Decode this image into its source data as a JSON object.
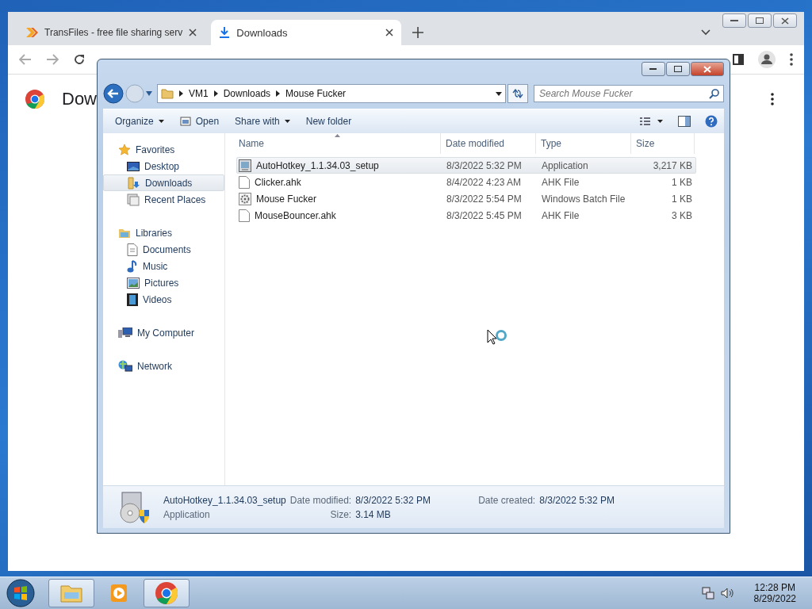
{
  "chrome": {
    "tabs": [
      {
        "label": "TransFiles - free file sharing serv",
        "selected": false,
        "kind": "transfiles"
      },
      {
        "label": "Downloads",
        "selected": true,
        "kind": "download"
      }
    ],
    "page_heading": "Dow"
  },
  "explorer": {
    "breadcrumb": [
      "VM1",
      "Downloads",
      "Mouse Fucker"
    ],
    "search": {
      "placeholder": "Search Mouse Fucker"
    },
    "commands": [
      {
        "label": "Organize",
        "kind": "menu"
      },
      {
        "label": "Open",
        "kind": "icon"
      },
      {
        "label": "Share with",
        "kind": "menu"
      },
      {
        "label": "New folder",
        "kind": "plain"
      }
    ],
    "nav": [
      {
        "label": "Favorites",
        "kind": "star",
        "children": [
          {
            "label": "Desktop",
            "kind": "desktop",
            "selected": false
          },
          {
            "label": "Downloads",
            "kind": "downloads",
            "selected": true
          },
          {
            "label": "Recent Places",
            "kind": "recent",
            "selected": false
          }
        ]
      },
      {
        "label": "Libraries",
        "kind": "library",
        "children": [
          {
            "label": "Documents",
            "kind": "document",
            "selected": false
          },
          {
            "label": "Music",
            "kind": "music",
            "selected": false
          },
          {
            "label": "Pictures",
            "kind": "pictures",
            "selected": false
          },
          {
            "label": "Videos",
            "kind": "videos",
            "selected": false
          }
        ]
      },
      {
        "label": "My Computer",
        "kind": "computer"
      },
      {
        "label": "Network",
        "kind": "network"
      }
    ],
    "columns": [
      "Name",
      "Date modified",
      "Type",
      "Size"
    ],
    "rows": [
      {
        "name": "AutoHotkey_1.1.34.03_setup",
        "date": "8/3/2022 5:32 PM",
        "type": "Application",
        "size": "3,217 KB",
        "kind": "installer",
        "selected": true
      },
      {
        "name": "Clicker.ahk",
        "date": "8/4/2022 4:23 AM",
        "type": "AHK File",
        "size": "1 KB",
        "kind": "text",
        "selected": false
      },
      {
        "name": "Mouse Fucker",
        "date": "8/3/2022 5:54 PM",
        "type": "Windows Batch File",
        "size": "1 KB",
        "kind": "batch",
        "selected": false
      },
      {
        "name": "MouseBouncer.ahk",
        "date": "8/3/2022 5:45 PM",
        "type": "AHK File",
        "size": "3 KB",
        "kind": "text",
        "selected": false
      }
    ],
    "details": {
      "name": "AutoHotkey_1.1.34.03_setup",
      "type": "Application",
      "modified_label": "Date modified:",
      "modified": "8/3/2022 5:32 PM",
      "size_label": "Size:",
      "size": "3.14 MB",
      "created_label": "Date created:",
      "created": "8/3/2022 5:32 PM"
    }
  },
  "taskbar": {
    "buttons": [
      {
        "kind": "explorer",
        "open": true
      },
      {
        "kind": "media",
        "open": false
      },
      {
        "kind": "chrome",
        "open": true
      }
    ],
    "time": "12:28 PM",
    "date": "8/29/2022"
  }
}
